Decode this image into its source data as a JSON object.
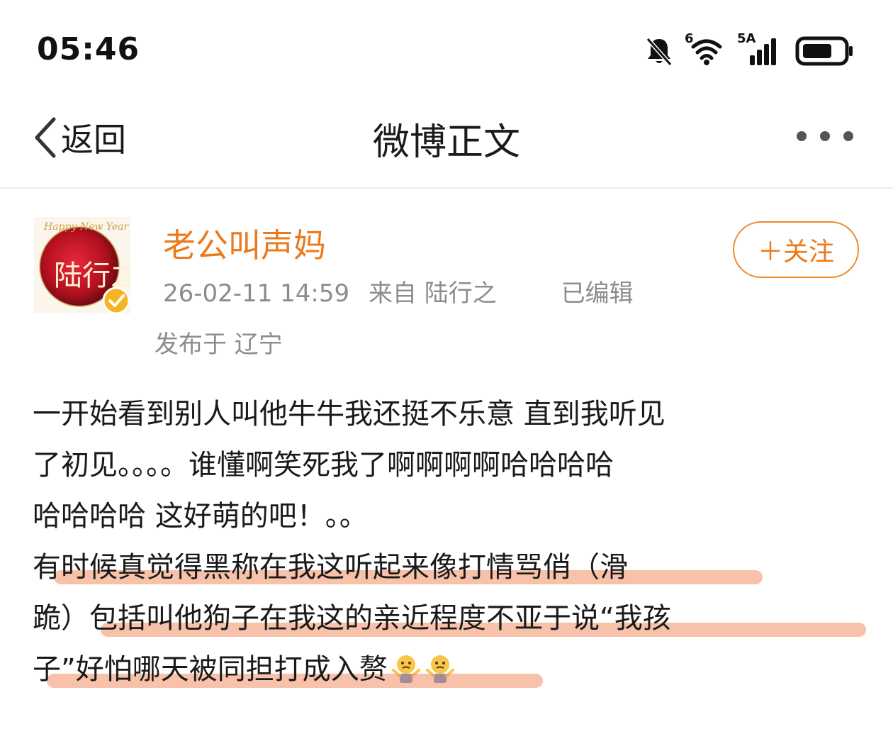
{
  "status_bar": {
    "time": "05:46",
    "signal_label": "5A",
    "wifi_label": "6"
  },
  "nav": {
    "back_label": "返回",
    "title": "微博正文"
  },
  "post": {
    "author": "老公叫声妈",
    "timestamp": "26-02-11 14:59",
    "source": "来自 陆行之",
    "edited": "已编辑",
    "location": "发布于 辽宁",
    "follow_label": "＋关注",
    "avatar_text": "陆行之",
    "lines": [
      "一开始看到别人叫他牛牛我还挺不乐意 直到我听见",
      "了初见。。。。谁懂啊笑死我了啊啊啊啊哈哈哈哈",
      "哈哈哈哈 这好萌的吧！。。",
      "有时候真觉得黑称在我这听起来像打情骂俏（滑",
      "跪）包括叫他狗子在我这的亲近程度不亚于说“我孩",
      "子”好怕哪天被同担打成入赘"
    ]
  },
  "colors": {
    "accent": "#ec7a1c",
    "highlight": "#f28e62",
    "muted": "#8c8c8c"
  },
  "icons": [
    "bell-off-icon",
    "wifi-icon",
    "signal-icon",
    "battery-icon",
    "back-chevron-icon",
    "more-icon",
    "verified-icon",
    "shrug-emoji-icon"
  ]
}
